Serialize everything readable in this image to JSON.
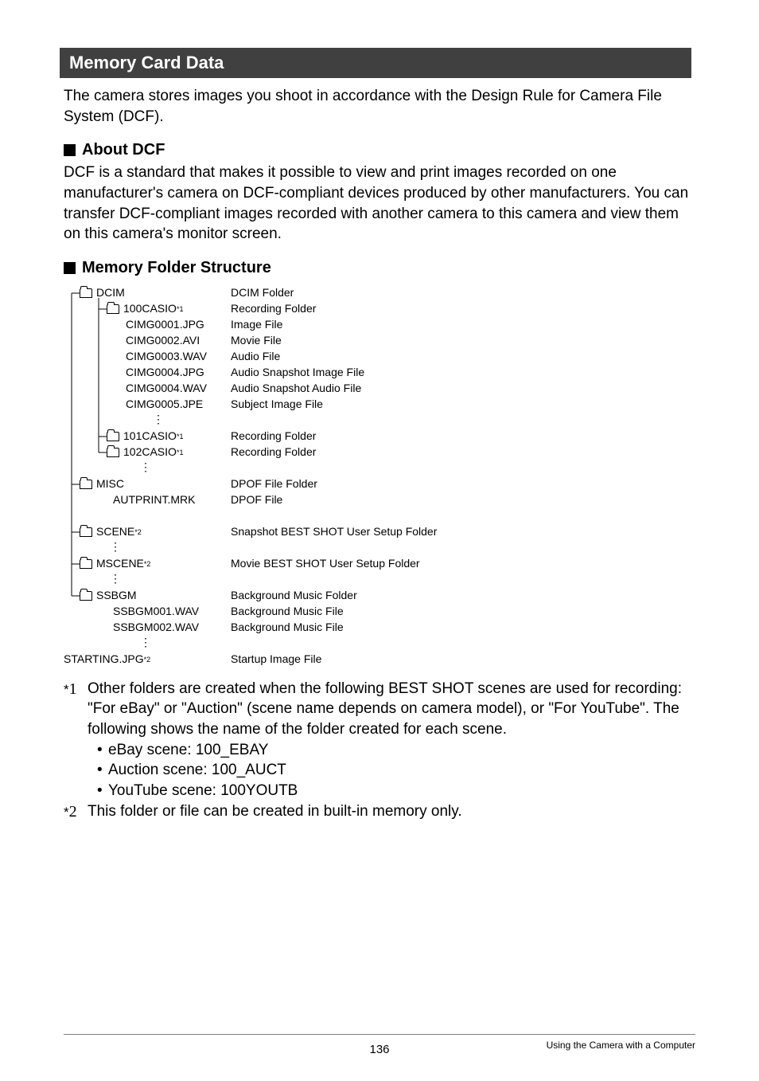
{
  "header": {
    "title": "Memory Card Data"
  },
  "intro": "The camera stores images you shoot in accordance with the Design Rule for Camera File System (DCF).",
  "about": {
    "heading": "About DCF",
    "text": "DCF is a standard that makes it possible to view and print images recorded on one manufacturer's camera on DCF-compliant devices produced by other manufacturers. You can transfer DCF-compliant images recorded with another camera to this camera and view them on this camera's monitor screen."
  },
  "structure": {
    "heading": "Memory Folder Structure"
  },
  "tree": {
    "items": [
      {
        "indent": 20,
        "folder": true,
        "label": "DCIM",
        "sup": "",
        "desc": "DCIM Folder"
      },
      {
        "indent": 54,
        "folder": true,
        "label": "100CASIO",
        "sup": "*1",
        "desc": "Recording Folder"
      },
      {
        "indent": 78,
        "folder": false,
        "label": "CIMG0001.JPG",
        "sup": "",
        "desc": "Image File"
      },
      {
        "indent": 78,
        "folder": false,
        "label": "CIMG0002.AVI",
        "sup": "",
        "desc": "Movie File"
      },
      {
        "indent": 78,
        "folder": false,
        "label": "CIMG0003.WAV",
        "sup": "",
        "desc": "Audio File"
      },
      {
        "indent": 78,
        "folder": false,
        "label": "CIMG0004.JPG",
        "sup": "",
        "desc": "Audio Snapshot Image File"
      },
      {
        "indent": 78,
        "folder": false,
        "label": "CIMG0004.WAV",
        "sup": "",
        "desc": "Audio Snapshot Audio File"
      },
      {
        "indent": 78,
        "folder": false,
        "label": "CIMG0005.JPE",
        "sup": "",
        "desc": "Subject Image File"
      },
      {
        "indent": 110,
        "folder": false,
        "label": "⋮",
        "sup": "",
        "desc": "",
        "dots": true
      },
      {
        "indent": 54,
        "folder": true,
        "label": "101CASIO",
        "sup": "*1",
        "desc": "Recording Folder"
      },
      {
        "indent": 54,
        "folder": true,
        "label": "102CASIO",
        "sup": "*1",
        "desc": "Recording Folder"
      },
      {
        "indent": 94,
        "folder": false,
        "label": "⋮",
        "sup": "",
        "desc": "",
        "dots": true
      },
      {
        "indent": 20,
        "folder": true,
        "label": "MISC",
        "sup": "",
        "desc": "DPOF File Folder"
      },
      {
        "indent": 62,
        "folder": false,
        "label": "AUTPRINT.MRK",
        "sup": "",
        "desc": "DPOF File"
      },
      {
        "indent": 0,
        "folder": false,
        "label": "",
        "sup": "",
        "desc": "",
        "spacer": true
      },
      {
        "indent": 20,
        "folder": true,
        "label": "SCENE",
        "sup": "*2",
        "desc": "Snapshot BEST SHOT User Setup Folder"
      },
      {
        "indent": 56,
        "folder": false,
        "label": "⋮",
        "sup": "",
        "desc": "",
        "dots": true
      },
      {
        "indent": 20,
        "folder": true,
        "label": "MSCENE",
        "sup": "*2",
        "desc": "Movie BEST SHOT User Setup Folder"
      },
      {
        "indent": 56,
        "folder": false,
        "label": "⋮",
        "sup": "",
        "desc": "",
        "dots": true
      },
      {
        "indent": 20,
        "folder": true,
        "label": "SSBGM",
        "sup": "",
        "desc": "Background Music Folder"
      },
      {
        "indent": 62,
        "folder": false,
        "label": "SSBGM001.WAV",
        "sup": "",
        "desc": "Background Music File"
      },
      {
        "indent": 62,
        "folder": false,
        "label": "SSBGM002.WAV",
        "sup": "",
        "desc": "Background Music File"
      },
      {
        "indent": 94,
        "folder": false,
        "label": "⋮",
        "sup": "",
        "desc": "",
        "dots": true
      },
      {
        "indent": 0,
        "folder": false,
        "label": "STARTING.JPG",
        "sup": "*2",
        "desc": "Startup Image File"
      }
    ]
  },
  "footnotes": {
    "n1": {
      "marker_star": "*",
      "marker_num": "1",
      "text": "Other folders are created when the following BEST SHOT scenes are used for recording: \"For eBay\" or \"Auction\" (scene name depends on camera model), or \"For YouTube\". The following shows the name of the folder created for each scene.",
      "bullets": [
        "eBay scene: 100_EBAY",
        "Auction scene: 100_AUCT",
        "YouTube scene: 100YOUTB"
      ]
    },
    "n2": {
      "marker_star": "*",
      "marker_num": "2",
      "text": "This folder or file can be created in built-in memory only."
    }
  },
  "footer": {
    "page": "136",
    "section": "Using the Camera with a Computer"
  }
}
